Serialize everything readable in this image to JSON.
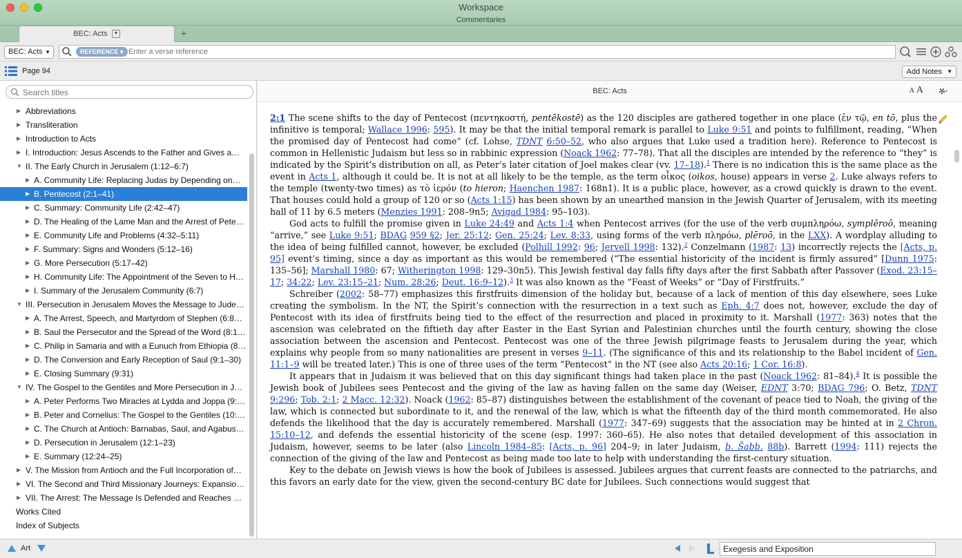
{
  "window": {
    "title": "Workspace",
    "subtitle": "Commentaries"
  },
  "tabs": [
    {
      "label": "BEC: Acts"
    }
  ],
  "toolbar": {
    "resource_select": "BEC: Acts",
    "search_pill": "REFERENCE",
    "search_placeholder": "Enter a verse reference",
    "icons": [
      "search-icon",
      "visual-filter-icon",
      "list-icon",
      "add-icon",
      "share-icon"
    ]
  },
  "nav": {
    "page_label": "Page 94",
    "add_notes_label": "Add Notes"
  },
  "sidebar": {
    "search_placeholder": "Search titles",
    "items": [
      {
        "label": "Abbreviations",
        "level": 0,
        "tri": "▶"
      },
      {
        "label": "Transliteration",
        "level": 0,
        "tri": "▶"
      },
      {
        "label": "Introduction to Acts",
        "level": 0,
        "tri": "▶"
      },
      {
        "label": "I. Introduction: Jesus Ascends to the Father and Gives a…",
        "level": 0,
        "tri": "▶"
      },
      {
        "label": "II. The Early Church in Jerusalem (1:12–6:7)",
        "level": 0,
        "tri": "▼"
      },
      {
        "label": "A. Community Life: Replacing Judas by Depending on…",
        "level": 1,
        "tri": "▶"
      },
      {
        "label": "B. Pentecost (2:1–41)",
        "level": 1,
        "tri": "▶",
        "selected": true
      },
      {
        "label": "C. Summary: Community Life (2:42–47)",
        "level": 1,
        "tri": "▶"
      },
      {
        "label": "D. The Healing of the Lame Man and the Arrest of Pete…",
        "level": 1,
        "tri": "▶"
      },
      {
        "label": "E. Community Life and Problems (4:32–5:11)",
        "level": 1,
        "tri": "▶"
      },
      {
        "label": "F. Summary: Signs and Wonders (5:12–16)",
        "level": 1,
        "tri": "▶"
      },
      {
        "label": "G. More Persecution (5:17–42)",
        "level": 1,
        "tri": "▶"
      },
      {
        "label": "H. Community Life: The Appointment of the Seven to H…",
        "level": 1,
        "tri": "▶"
      },
      {
        "label": "I. Summary of the Jerusalem Community (6:7)",
        "level": 1,
        "tri": "▶"
      },
      {
        "label": "III. Persecution in Jerusalem Moves the Message to Jude…",
        "level": 0,
        "tri": "▼"
      },
      {
        "label": "A. The Arrest, Speech, and Martyrdom of Stephen (6:8…",
        "level": 1,
        "tri": "▶"
      },
      {
        "label": "B. Saul the Persecutor and the Spread of the Word (8:1…",
        "level": 1,
        "tri": "▶"
      },
      {
        "label": "C. Philip in Samaria and with a Eunuch from Ethiopia (8…",
        "level": 1,
        "tri": "▶"
      },
      {
        "label": "D. The Conversion and Early Reception of Saul (9:1–30)",
        "level": 1,
        "tri": "▶"
      },
      {
        "label": "E. Closing Summary (9:31)",
        "level": 1,
        "tri": "▶"
      },
      {
        "label": "IV. The Gospel to the Gentiles and More Persecution in J…",
        "level": 0,
        "tri": "▼"
      },
      {
        "label": "A. Peter Performs Two Miracles at Lydda and Joppa (9:…",
        "level": 1,
        "tri": "▶"
      },
      {
        "label": "B. Peter and Cornelius: The Gospel to the Gentiles (10:…",
        "level": 1,
        "tri": "▶"
      },
      {
        "label": "C. The Church at Antioch: Barnabas, Saul, and Agabus…",
        "level": 1,
        "tri": "▶"
      },
      {
        "label": "D. Persecution in Jerusalem (12:1–23)",
        "level": 1,
        "tri": "▶"
      },
      {
        "label": "E. Summary (12:24–25)",
        "level": 1,
        "tri": "▶"
      },
      {
        "label": "V. The Mission from Antioch and the Full Incorporation of…",
        "level": 0,
        "tri": "▶"
      },
      {
        "label": "VI. The Second and Third Missionary Journeys: Expansio…",
        "level": 0,
        "tri": "▶"
      },
      {
        "label": "VII. The Arrest: The Message Is Defended and Reaches R…",
        "level": 0,
        "tri": "▶"
      },
      {
        "label": "Works Cited",
        "level": -1,
        "tri": ""
      },
      {
        "label": "Index of Subjects",
        "level": -1,
        "tri": ""
      }
    ]
  },
  "content": {
    "header_title": "BEC: Acts",
    "font_small": "A",
    "font_large": "A",
    "paragraphs": [
      [
        [
          "ref",
          "2:1"
        ],
        [
          "t",
          " The scene shifts to the day of Pentecost ("
        ],
        [
          "g",
          "πεντηκοστή, "
        ],
        [
          "i",
          "pentēkostē"
        ],
        [
          "t",
          ") as the 120 disciples are gathered together in one place ("
        ],
        [
          "g",
          "ἐν τῷ, "
        ],
        [
          "i",
          "en tō"
        ],
        [
          "t",
          ", plus the infinitive is temporal; "
        ],
        [
          "a",
          "Wallace 1996"
        ],
        [
          "t",
          ": "
        ],
        [
          "a",
          "595"
        ],
        [
          "t",
          "). It may be that the initial temporal remark is parallel to "
        ],
        [
          "a",
          "Luke 9:51"
        ],
        [
          "t",
          " and points to fulfillment, reading, “When the promised day of Pentecost had come” (cf. Lohse, "
        ],
        [
          "ai",
          "TDNT"
        ],
        [
          "t",
          " "
        ],
        [
          "a",
          "6:50–52"
        ],
        [
          "t",
          ", who also argues that Luke used a tradition here). Reference to Pentecost is common in Hellenistic Judaism but less so in rabbinic expression ("
        ],
        [
          "a",
          "Noack 1962"
        ],
        [
          "t",
          ": 77–78). That all the disciples are intended by the reference to “they” is indicated by the Spirit’s distribution on all, as Peter’s later citation of Joel makes clear (vv. "
        ],
        [
          "a",
          "17–18"
        ],
        [
          "t",
          ")."
        ],
        [
          "sup",
          "1"
        ],
        [
          "t",
          " There is no indication this is the same place as the event in "
        ],
        [
          "a",
          "Acts 1"
        ],
        [
          "t",
          ", although it could be. It is not at all likely to be the temple, as the term "
        ],
        [
          "g",
          "οἶκος "
        ],
        [
          "t",
          "("
        ],
        [
          "i",
          "oikos"
        ],
        [
          "t",
          ", house) appears in verse "
        ],
        [
          "a",
          "2"
        ],
        [
          "t",
          ". Luke always refers to the temple (twenty-two times) as "
        ],
        [
          "g",
          "τὸ ἱερόν "
        ],
        [
          "t",
          "("
        ],
        [
          "i",
          "to hieron"
        ],
        [
          "t",
          "; "
        ],
        [
          "a",
          "Haenchen 1987"
        ],
        [
          "t",
          ": 168n1). It is a public place, however, as a crowd quickly is drawn to the event. That houses could hold a group of 120 or so ("
        ],
        [
          "a",
          "Acts 1:15"
        ],
        [
          "t",
          ") has been shown by an unearthed mansion in the Jewish Quarter of Jerusalem, with its meeting hall of 11 by 6.5 meters ("
        ],
        [
          "a",
          "Menzies 1991"
        ],
        [
          "t",
          ": 208–9n5; "
        ],
        [
          "a",
          "Avigad 1984"
        ],
        [
          "t",
          ": 95–103)."
        ]
      ],
      [
        [
          "t",
          "God acts to fulfill the promise given in "
        ],
        [
          "a",
          "Luke 24:49"
        ],
        [
          "t",
          " and "
        ],
        [
          "a",
          "Acts 1:4"
        ],
        [
          "t",
          " when Pentecost arrives (for the use of the verb "
        ],
        [
          "g",
          "συμπληρόω, "
        ],
        [
          "i",
          "symplēroō"
        ],
        [
          "t",
          ", meaning “arrive,” see "
        ],
        [
          "a",
          "Luke 9:51"
        ],
        [
          "t",
          "; "
        ],
        [
          "a",
          "BDAG"
        ],
        [
          "t",
          " "
        ],
        [
          "a",
          "959 §2"
        ],
        [
          "t",
          "; "
        ],
        [
          "a",
          "Jer. 25:12"
        ],
        [
          "t",
          "; "
        ],
        [
          "a",
          "Gen. 25:24"
        ],
        [
          "t",
          "; "
        ],
        [
          "a",
          "Lev. 8:33"
        ],
        [
          "t",
          ", using forms of the verb "
        ],
        [
          "g",
          "πληρόω, "
        ],
        [
          "i",
          "plēroō"
        ],
        [
          "t",
          ", in the "
        ],
        [
          "a",
          "LXX"
        ],
        [
          "t",
          "). A wordplay alluding to the idea of being fulfilled cannot, however, be excluded ("
        ],
        [
          "a",
          "Polhill 1992"
        ],
        [
          "t",
          ": "
        ],
        [
          "a",
          "96"
        ],
        [
          "t",
          "; "
        ],
        [
          "a",
          "Jervell 1998"
        ],
        [
          "t",
          ": 132)."
        ],
        [
          "sup",
          "2"
        ],
        [
          "t",
          " Conzelmann ("
        ],
        [
          "a",
          "1987"
        ],
        [
          "t",
          ": "
        ],
        [
          "a",
          "13"
        ],
        [
          "t",
          ") incorrectly rejects the "
        ],
        [
          "a",
          "[Acts, p. 95]"
        ],
        [
          "t",
          " event’s timing, since a day as important as this would be remembered (“The essential historicity of the incident is firmly assured” ["
        ],
        [
          "a",
          "Dunn 1975"
        ],
        [
          "t",
          ": 135–56]; "
        ],
        [
          "a",
          "Marshall 1980"
        ],
        [
          "t",
          ": 67; "
        ],
        [
          "a",
          "Witherington 1998"
        ],
        [
          "t",
          ": 129–30n5). This Jewish festival day falls fifty days after the first Sabbath after Passover ("
        ],
        [
          "a",
          "Exod. 23:15–17"
        ],
        [
          "t",
          "; "
        ],
        [
          "a",
          "34:22"
        ],
        [
          "t",
          "; "
        ],
        [
          "a",
          "Lev. 23:15–21"
        ],
        [
          "t",
          "; "
        ],
        [
          "a",
          "Num. 28:26"
        ],
        [
          "t",
          "; "
        ],
        [
          "a",
          "Deut. 16:9–12"
        ],
        [
          "t",
          ")."
        ],
        [
          "sup",
          "3"
        ],
        [
          "t",
          " It was also known as the “Feast of Weeks” or “Day of Firstfruits.”"
        ]
      ],
      [
        [
          "t",
          "Schreiber ("
        ],
        [
          "a",
          "2002"
        ],
        [
          "t",
          ": 58–77) emphasizes this firstfruits dimension of the holiday but, because of a lack of mention of this day elsewhere, sees Luke creating the symbolism. In the NT, the Spirit’s connection with the resurrection in a text such as "
        ],
        [
          "a",
          "Eph. 4:7"
        ],
        [
          "t",
          " does not, however, exclude the day of Pentecost with its idea of firstfruits being tied to the effect of the resurrection and placed in proximity to it. Marshall ("
        ],
        [
          "a",
          "1977"
        ],
        [
          "t",
          ": 363) notes that the ascension was celebrated on the fiftieth day after Easter in the East Syrian and Palestinian churches until the fourth century, showing the close association between the ascension and Pentecost. Pentecost was one of the three Jewish pilgrimage feasts to Jerusalem during the year, which explains why people from so many nationalities are present in verses "
        ],
        [
          "a",
          "9–11"
        ],
        [
          "t",
          ". (The significance of this and its relationship to the Babel incident of "
        ],
        [
          "a",
          "Gen. 11:1–9"
        ],
        [
          "t",
          " will be treated later.) This is one of three uses of the term “Pentecost” in the NT (see also "
        ],
        [
          "a",
          "Acts 20:16"
        ],
        [
          "t",
          "; "
        ],
        [
          "a",
          "1 Cor. 16:8"
        ],
        [
          "t",
          ")."
        ]
      ],
      [
        [
          "t",
          "It appears that in Judaism it was believed that on this day significant things had taken place in the past ("
        ],
        [
          "a",
          "Noack 1962"
        ],
        [
          "t",
          ": 81–84)."
        ],
        [
          "sup",
          "4"
        ],
        [
          "t",
          " It is possible the Jewish book of Jubilees sees Pentecost and the giving of the law as having fallen on the same day (Weiser, "
        ],
        [
          "ai",
          "EDNT"
        ],
        [
          "t",
          " 3:70; "
        ],
        [
          "a",
          "BDAG 796"
        ],
        [
          "t",
          "; O. Betz, "
        ],
        [
          "ai",
          "TDNT"
        ],
        [
          "t",
          " "
        ],
        [
          "a",
          "9:296"
        ],
        [
          "t",
          "; "
        ],
        [
          "a",
          "Tob. 2:1"
        ],
        [
          "t",
          "; "
        ],
        [
          "a",
          "2 Macc. 12:32"
        ],
        [
          "t",
          "). Noack ("
        ],
        [
          "a",
          "1962"
        ],
        [
          "t",
          ": 85–87) distinguishes between the establishment of the covenant of peace tied to Noah, the giving of the law, which is connected but subordinate to it, and the renewal of the law, which is what the fifteenth day of the third month commemorated. He also defends the likelihood that the day is accurately remembered. Marshall ("
        ],
        [
          "a",
          "1977"
        ],
        [
          "t",
          ": 347–69) suggests that the association may be hinted at in "
        ],
        [
          "a",
          "2 Chron. 15:10–12"
        ],
        [
          "t",
          ", and defends the essential historicity of the scene (esp. 1997: 360–65). He also notes that detailed development of this association in Judaism, however, seems to be later (also "
        ],
        [
          "a",
          "Lincoln 1984–85"
        ],
        [
          "t",
          ": "
        ],
        [
          "a",
          "[Acts, p. 96]"
        ],
        [
          "t",
          " 204–9; in later Judaism, "
        ],
        [
          "ai",
          "b. Šabb."
        ],
        [
          "t",
          " "
        ],
        [
          "a",
          "88b"
        ],
        [
          "t",
          "). Barrett ("
        ],
        [
          "a",
          "1994"
        ],
        [
          "t",
          ": 111) rejects the connection of the giving of the law and Pentecost as being made too late to help with understanding the first-century situation."
        ]
      ],
      [
        [
          "t",
          "Key to the debate on Jewish views is how the book of Jubilees is assessed. Jubilees argues that current feasts are connected to the patriarchs, and this favors an early date for the view, given the second-century BC date for Jubilees. Such connections would suggest that"
        ]
      ]
    ]
  },
  "bottombar": {
    "label": "Art",
    "section": "Exegesis and Exposition"
  },
  "colors": {
    "titlebar": "#b1d1b9",
    "selection": "#2a7fd6",
    "link": "#1640b8",
    "pill": "#8ba8c6"
  }
}
